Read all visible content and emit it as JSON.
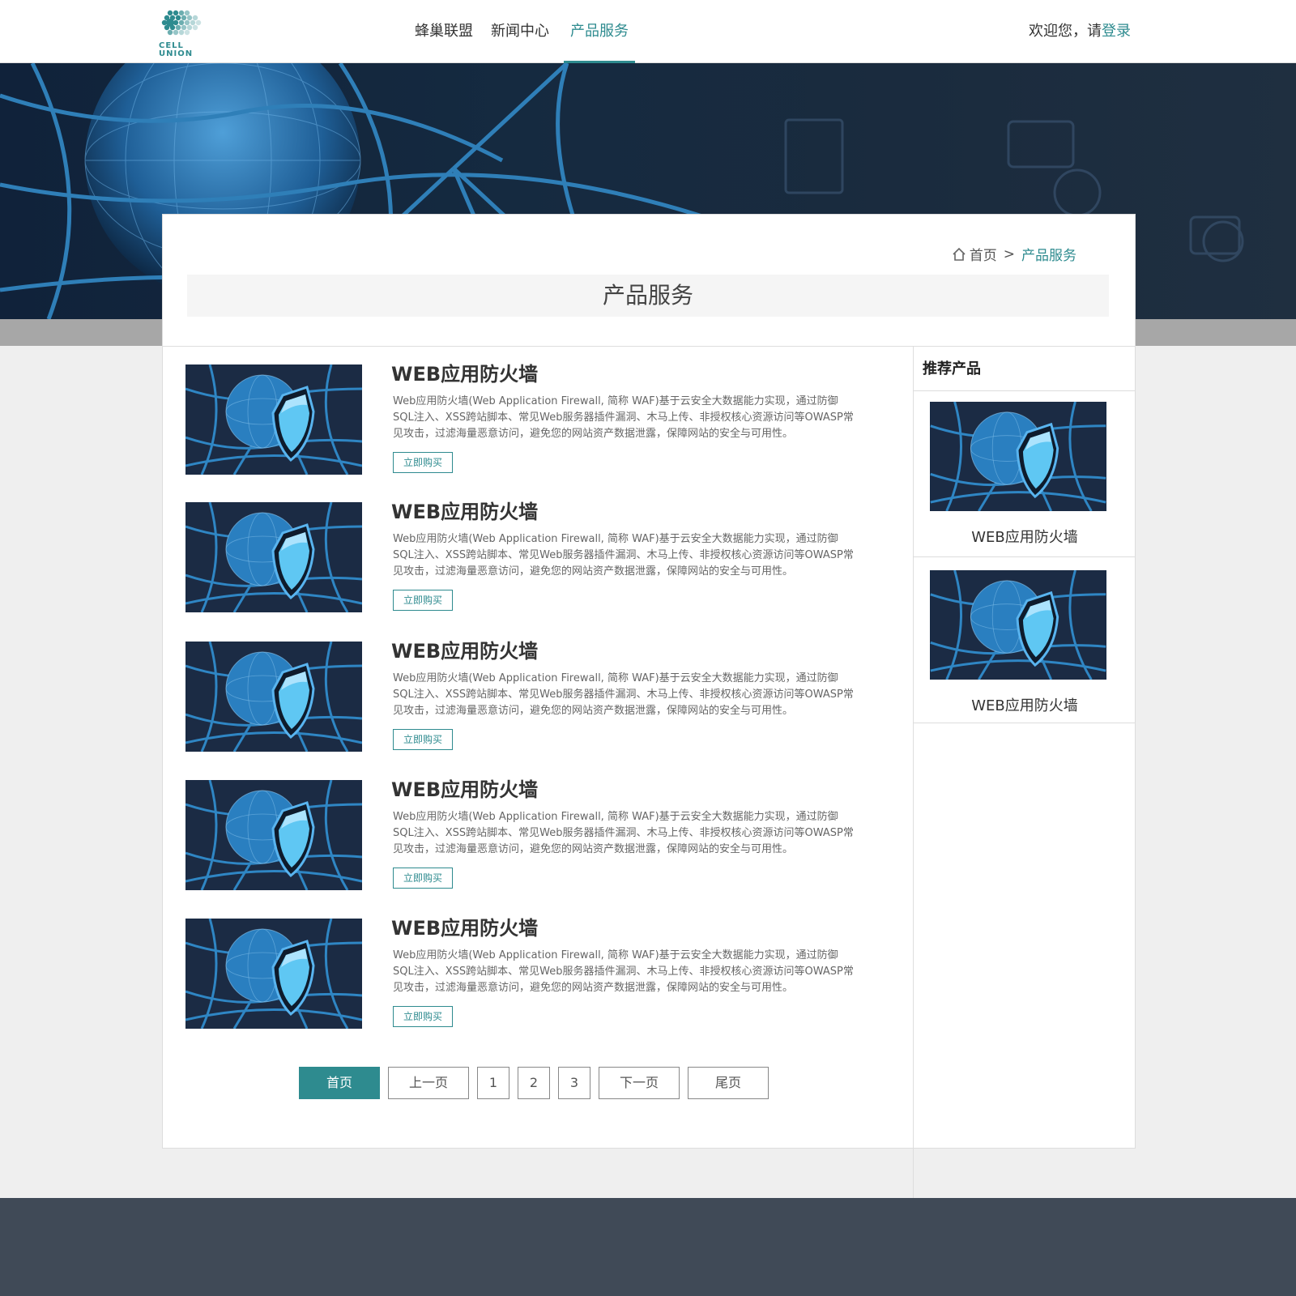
{
  "header": {
    "logo_text": "CELL UNION",
    "nav": [
      {
        "label": "蜂巢联盟"
      },
      {
        "label": "新闻中心"
      },
      {
        "label": "产品服务",
        "active": true
      }
    ],
    "welcome_prefix": "欢迎您，请",
    "login_label": "登录"
  },
  "breadcrumb": {
    "home": "首页",
    "sep": ">",
    "current": "产品服务"
  },
  "page_title": "产品服务",
  "products": [
    {
      "title": "WEB应用防火墙",
      "desc": " Web应用防火墙(Web Application Firewall, 简称 WAF)基于云安全大数据能力实现，通过防御SQL注入、XSS跨站脚本、常见Web服务器插件漏洞、木马上传、非授权核心资源访问等OWASP常见攻击，过滤海量恶意访问，避免您的网站资产数据泄露，保障网站的安全与可用性。",
      "buy": "立即购买"
    },
    {
      "title": "WEB应用防火墙",
      "desc": " Web应用防火墙(Web Application Firewall, 简称 WAF)基于云安全大数据能力实现，通过防御SQL注入、XSS跨站脚本、常见Web服务器插件漏洞、木马上传、非授权核心资源访问等OWASP常见攻击，过滤海量恶意访问，避免您的网站资产数据泄露，保障网站的安全与可用性。",
      "buy": "立即购买"
    },
    {
      "title": "WEB应用防火墙",
      "desc": " Web应用防火墙(Web Application Firewall, 简称 WAF)基于云安全大数据能力实现，通过防御SQL注入、XSS跨站脚本、常见Web服务器插件漏洞、木马上传、非授权核心资源访问等OWASP常见攻击，过滤海量恶意访问，避免您的网站资产数据泄露，保障网站的安全与可用性。",
      "buy": "立即购买"
    },
    {
      "title": "WEB应用防火墙",
      "desc": " Web应用防火墙(Web Application Firewall, 简称 WAF)基于云安全大数据能力实现，通过防御SQL注入、XSS跨站脚本、常见Web服务器插件漏洞、木马上传、非授权核心资源访问等OWASP常见攻击，过滤海量恶意访问，避免您的网站资产数据泄露，保障网站的安全与可用性。",
      "buy": "立即购买"
    },
    {
      "title": "WEB应用防火墙",
      "desc": " Web应用防火墙(Web Application Firewall, 简称 WAF)基于云安全大数据能力实现，通过防御SQL注入、XSS跨站脚本、常见Web服务器插件漏洞、木马上传、非授权核心资源访问等OWASP常见攻击，过滤海量恶意访问，避免您的网站资产数据泄露，保障网站的安全与可用性。",
      "buy": "立即购买"
    }
  ],
  "pagination": {
    "first": "首页",
    "prev": "上一页",
    "pages": [
      "1",
      "2",
      "3"
    ],
    "next": "下一页",
    "last": "尾页"
  },
  "sidebar": {
    "heading": "推荐产品",
    "items": [
      {
        "label": "WEB应用防火墙"
      },
      {
        "label": "WEB应用防火墙"
      }
    ]
  },
  "colors": {
    "accent": "#2e8b8f",
    "footer": "#404a57",
    "banner": "#152a40"
  }
}
